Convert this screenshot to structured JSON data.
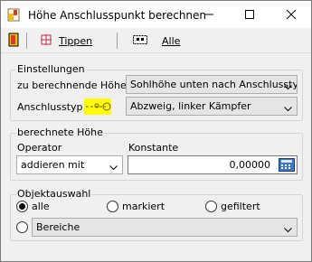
{
  "window": {
    "title": "Höhe Anschlusspunkt berechnen"
  },
  "toolbar": {
    "tippen_label": "Tippen",
    "alle_label": "Alle"
  },
  "einstellungen": {
    "group_title": "Einstellungen",
    "height_label": "zu berechnende Höhe",
    "height_value": "Sohlhöhe unten nach Anschlusstyp",
    "type_label": "Anschlusstyp",
    "type_value": "Abzweig, linker Kämpfer"
  },
  "berechnete": {
    "group_title": "berechnete Höhe",
    "operator_label": "Operator",
    "operator_value": "addieren mit",
    "konstante_label": "Konstante",
    "konstante_value": "0,00000"
  },
  "objektauswahl": {
    "group_title": "Objektauswahl",
    "radio_alle": "alle",
    "radio_markiert": "markiert",
    "radio_gefiltert": "gefiltert",
    "bereiche_value": "Bereiche",
    "selected": "alle"
  }
}
